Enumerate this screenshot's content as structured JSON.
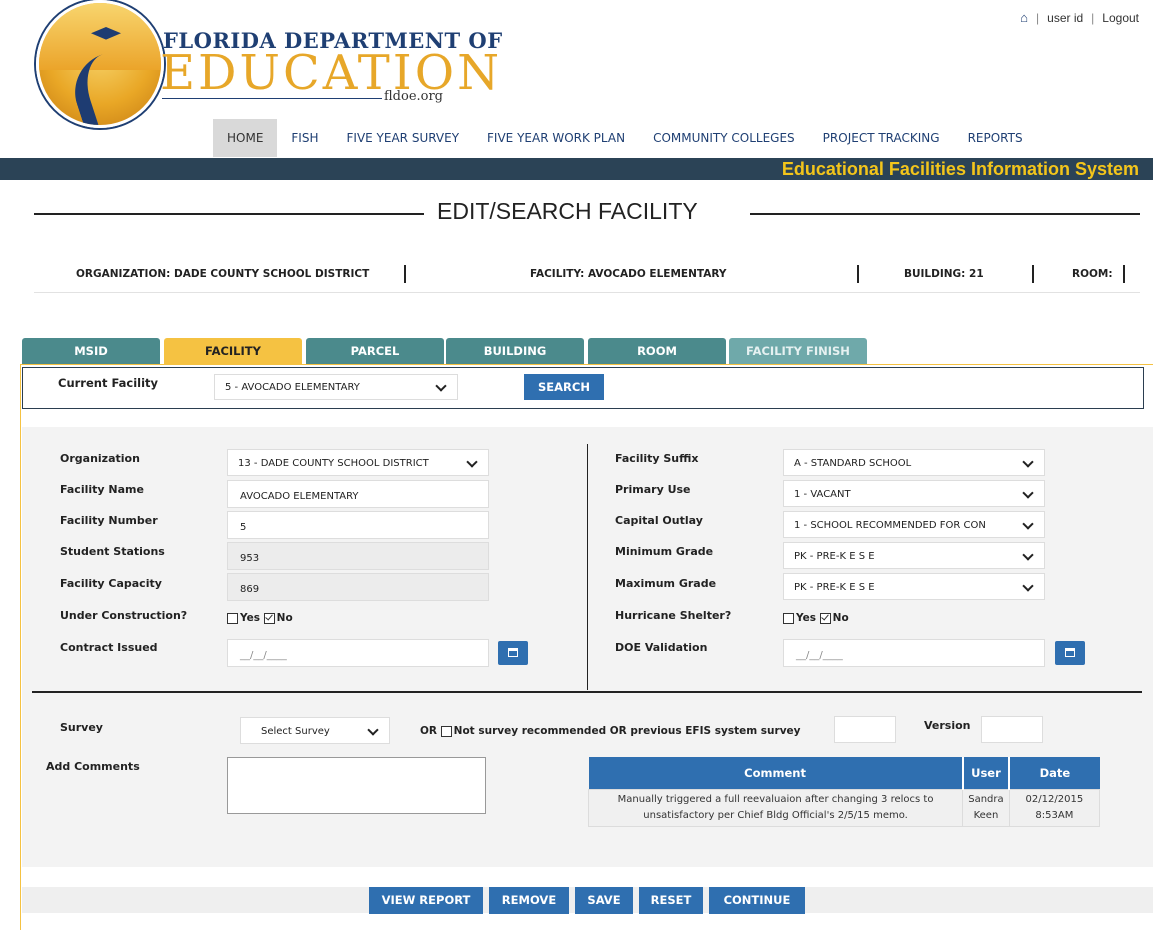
{
  "header": {
    "brand_line1": "FLORIDA DEPARTMENT OF",
    "brand_line2": "EDUCATION",
    "brand_url": "fldoe.org",
    "user_id": "user id",
    "logout": "Logout",
    "banner": "Educational Facilities Information System"
  },
  "nav": [
    "HOME",
    "FISH",
    "FIVE YEAR SURVEY",
    "FIVE YEAR WORK PLAN",
    "COMMUNITY COLLEGES",
    "PROJECT TRACKING",
    "REPORTS"
  ],
  "page_title": "EDIT/SEARCH FACILITY",
  "context": {
    "organization": "ORGANIZATION: DADE COUNTY SCHOOL DISTRICT",
    "facility": "FACILITY: AVOCADO ELEMENTARY",
    "building": "BUILDING: 21",
    "room": "ROOM:"
  },
  "tabs": [
    "MSID",
    "FACILITY",
    "PARCEL",
    "BUILDING",
    "ROOM",
    "FACILITY FINISH"
  ],
  "current_facility": {
    "label": "Current Facility",
    "value": "5 - AVOCADO ELEMENTARY",
    "search": "SEARCH"
  },
  "left_form": {
    "organization_label": "Organization",
    "organization_value": "13 - DADE COUNTY SCHOOL DISTRICT",
    "facility_name_label": "Facility Name",
    "facility_name_value": "AVOCADO ELEMENTARY",
    "facility_number_label": "Facility Number",
    "facility_number_value": "5",
    "student_stations_label": "Student Stations",
    "student_stations_value": "953",
    "facility_capacity_label": "Facility Capacity",
    "facility_capacity_value": "869",
    "under_construction_label": "Under Construction?",
    "yes": "Yes",
    "no": "No",
    "contract_issued_label": "Contract Issued",
    "contract_issued_value": "__/__/____"
  },
  "right_form": {
    "facility_suffix_label": "Facility Suffix",
    "facility_suffix_value": "A - STANDARD SCHOOL",
    "primary_use_label": "Primary Use",
    "primary_use_value": "1 - VACANT",
    "capital_outlay_label": "Capital Outlay",
    "capital_outlay_value": "1 - SCHOOL RECOMMENDED FOR CON",
    "minimum_grade_label": "Minimum Grade",
    "minimum_grade_value": "PK - PRE-K E S E",
    "maximum_grade_label": "Maximum Grade",
    "maximum_grade_value": "PK - PRE-K E S E",
    "hurricane_label": "Hurricane Shelter?",
    "yes": "Yes",
    "no": "No",
    "doe_validation_label": "DOE Validation",
    "doe_validation_value": "__/__/____"
  },
  "survey": {
    "label": "Survey",
    "select_value": "Select Survey",
    "or_text": "OR",
    "not_recommended_text": "Not survey recommended OR previous EFIS system survey",
    "version_label": "Version"
  },
  "comments": {
    "label": "Add Comments",
    "headers": [
      "Comment",
      "User",
      "Date"
    ],
    "rows": [
      {
        "comment": "Manually triggered a full reevaluaion after changing 3 relocs to unsatisfactory per Chief Bldg Official's 2/5/15 memo.",
        "user": "Sandra Keen",
        "date": "02/12/2015 8:53AM"
      }
    ]
  },
  "footer_buttons": [
    "VIEW REPORT",
    "REMOVE",
    "SAVE",
    "RESET",
    "CONTINUE"
  ]
}
